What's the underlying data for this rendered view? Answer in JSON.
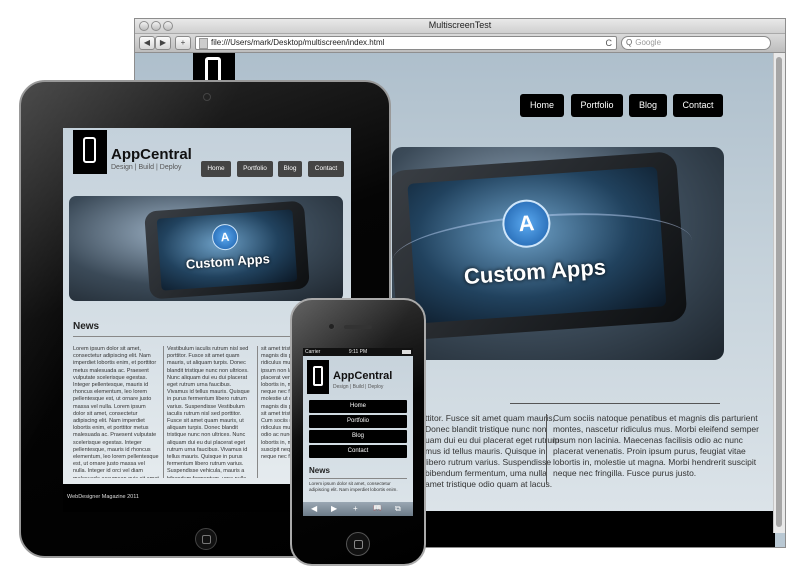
{
  "browser": {
    "window_title": "MultiscreenTest",
    "url": "file:///Users/mark/Desktop/multiscreen/index.html",
    "search_placeholder": "Google",
    "back": "◀",
    "forward": "▶",
    "add": "+",
    "reload": "C",
    "search_icon": "Q"
  },
  "desktop_site": {
    "nav": [
      "Home",
      "Portfolio",
      "Blog",
      "Contact"
    ],
    "hero_text": "Custom Apps",
    "col1": [
      "ttitor. Fusce sit amet quam mauris,",
      "Donec blandit tristique nunc non",
      "uam dui eu dui placerat eget rutrum",
      "mus id tellus mauris. Quisque in",
      "libero rutrum varius. Suspendisse",
      "bibendum fermentum, uma nulla",
      "amet tristique odio quam at lacus."
    ],
    "col2": [
      "Cum sociis natoque penatibus et magnis dis parturient",
      "montes, nascetur ridiculus mus. Morbi eleifend semper",
      "ipsum non lacinia. Maecenas facilisis odio ac nunc",
      "placerat venenatis. Proin ipsum purus, feugiat vitae",
      "lobortis in, molestie ut magna. Morbi hendrerit suscipit",
      "neque nec fringilla. Fusce purus justo."
    ]
  },
  "tablet_site": {
    "brand": "AppCentral",
    "tagline": "Design | Build | Deploy",
    "nav": [
      "Home",
      "Portfolio",
      "Blog",
      "Contact"
    ],
    "hero_text": "Custom Apps",
    "news_heading": "News",
    "col1": "Lorem ipsum dolor sit amet, consectetur adipiscing elit. Nam imperdiet lobortis enim, et porttitor metus malesuada ac. Praesent vulputate scelerisque egestas. Integer pellentesque, mauris id rhoncus elementum, leo lorem pellentesque est, ut ornare justo massa vel nulla. Lorem ipsum dolor sit amet, consectetur adipiscing elit. Nam imperdiet lobortis enim, et porttitor metus malesuada ac. Praesent vulputate scelerisque egestas. Integer pellentesque, mauris id rhoncus elementum, leo lorem pellentesque est, ut ornare justo massa vel nulla. Integer id orci vel diam malesuada accumsan quis sit amet lectus.",
    "col2": "Vestibulum iaculis rutrum nisl sed porttitor. Fusce sit amet quam mauris, ut aliquam turpis. Donec blandit tristique nunc non ultrices. Nunc aliquam dui eu dui placerat eget rutrum urna faucibus. Vivamus id tellus mauris. Quisque in purus fermentum libero rutrum varius. Suspendisse Vestibulum iaculis rutrum nisl sed porttitor. Fusce sit amet quam mauris, ut aliquam turpis. Donec blandit tristique nunc non ultrices. Nunc aliquam dui eu dui placerat eget rutrum urna faucibus. Vivamus id tellus mauris. Quisque in purus fermentum libero rutrum varius. Suspendisse vehicula, mauris a bibendum fermentum, urna nulla fermentum nisi.",
    "col3": "sit amet trist magnis dis pa ridiculus mus. ipsum non lac placerat ven lobortis in, m neque nec fr molestie ut m magnis dis pa sit amet tristi Cum sociis n ridiculus mus. odio ac nunc lobortis in, m suscipit neque neque nec fr",
    "footer": "WebDesigner Magazine 2011"
  },
  "phone_site": {
    "carrier": "Carrier",
    "time": "9:11 PM",
    "brand": "AppCentral",
    "tagline": "Design | Build | Deploy",
    "nav": [
      "Home",
      "Portfolio",
      "Blog",
      "Contact"
    ],
    "news_heading": "News",
    "text": "Lorem ipsum dolor sit amet, consectetur adipiscing elit. Nam imperdiet lobortis enim.",
    "toolbar": [
      "◀",
      "▶",
      "+",
      "📖",
      "⧉"
    ]
  }
}
